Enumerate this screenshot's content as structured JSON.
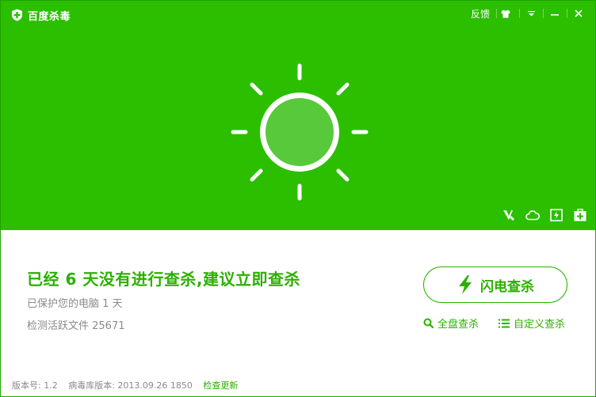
{
  "app": {
    "title": "百度杀毒"
  },
  "titlebar": {
    "feedback": "反馈",
    "min_glyph": "—",
    "close_glyph": "✕",
    "menu_glyph": "▾"
  },
  "hero": {
    "state": "sunny",
    "accent": "#2bbf00"
  },
  "status": {
    "headline": "已经 6 天没有进行查杀,建议立即查杀",
    "protected": "已保护您的电脑 1 天",
    "files": "检测活跃文件 25671"
  },
  "actions": {
    "quick_scan": "闪电查杀",
    "full_scan": "全盘查杀",
    "custom_scan": "自定义查杀"
  },
  "footer": {
    "version": "版本号: 1.2",
    "db_version": "病毒库版本: 2013.09.26 1850",
    "check_update": "检查更新"
  },
  "icons": [
    "shield-logo-icon",
    "shirt-skin-icon",
    "chevron-down-icon",
    "minimize-icon",
    "close-icon",
    "sun-icon",
    "tool-trust-icon",
    "cloud-icon",
    "flash-box-icon",
    "medkit-icon",
    "lightning-icon",
    "search-icon",
    "list-icon"
  ]
}
